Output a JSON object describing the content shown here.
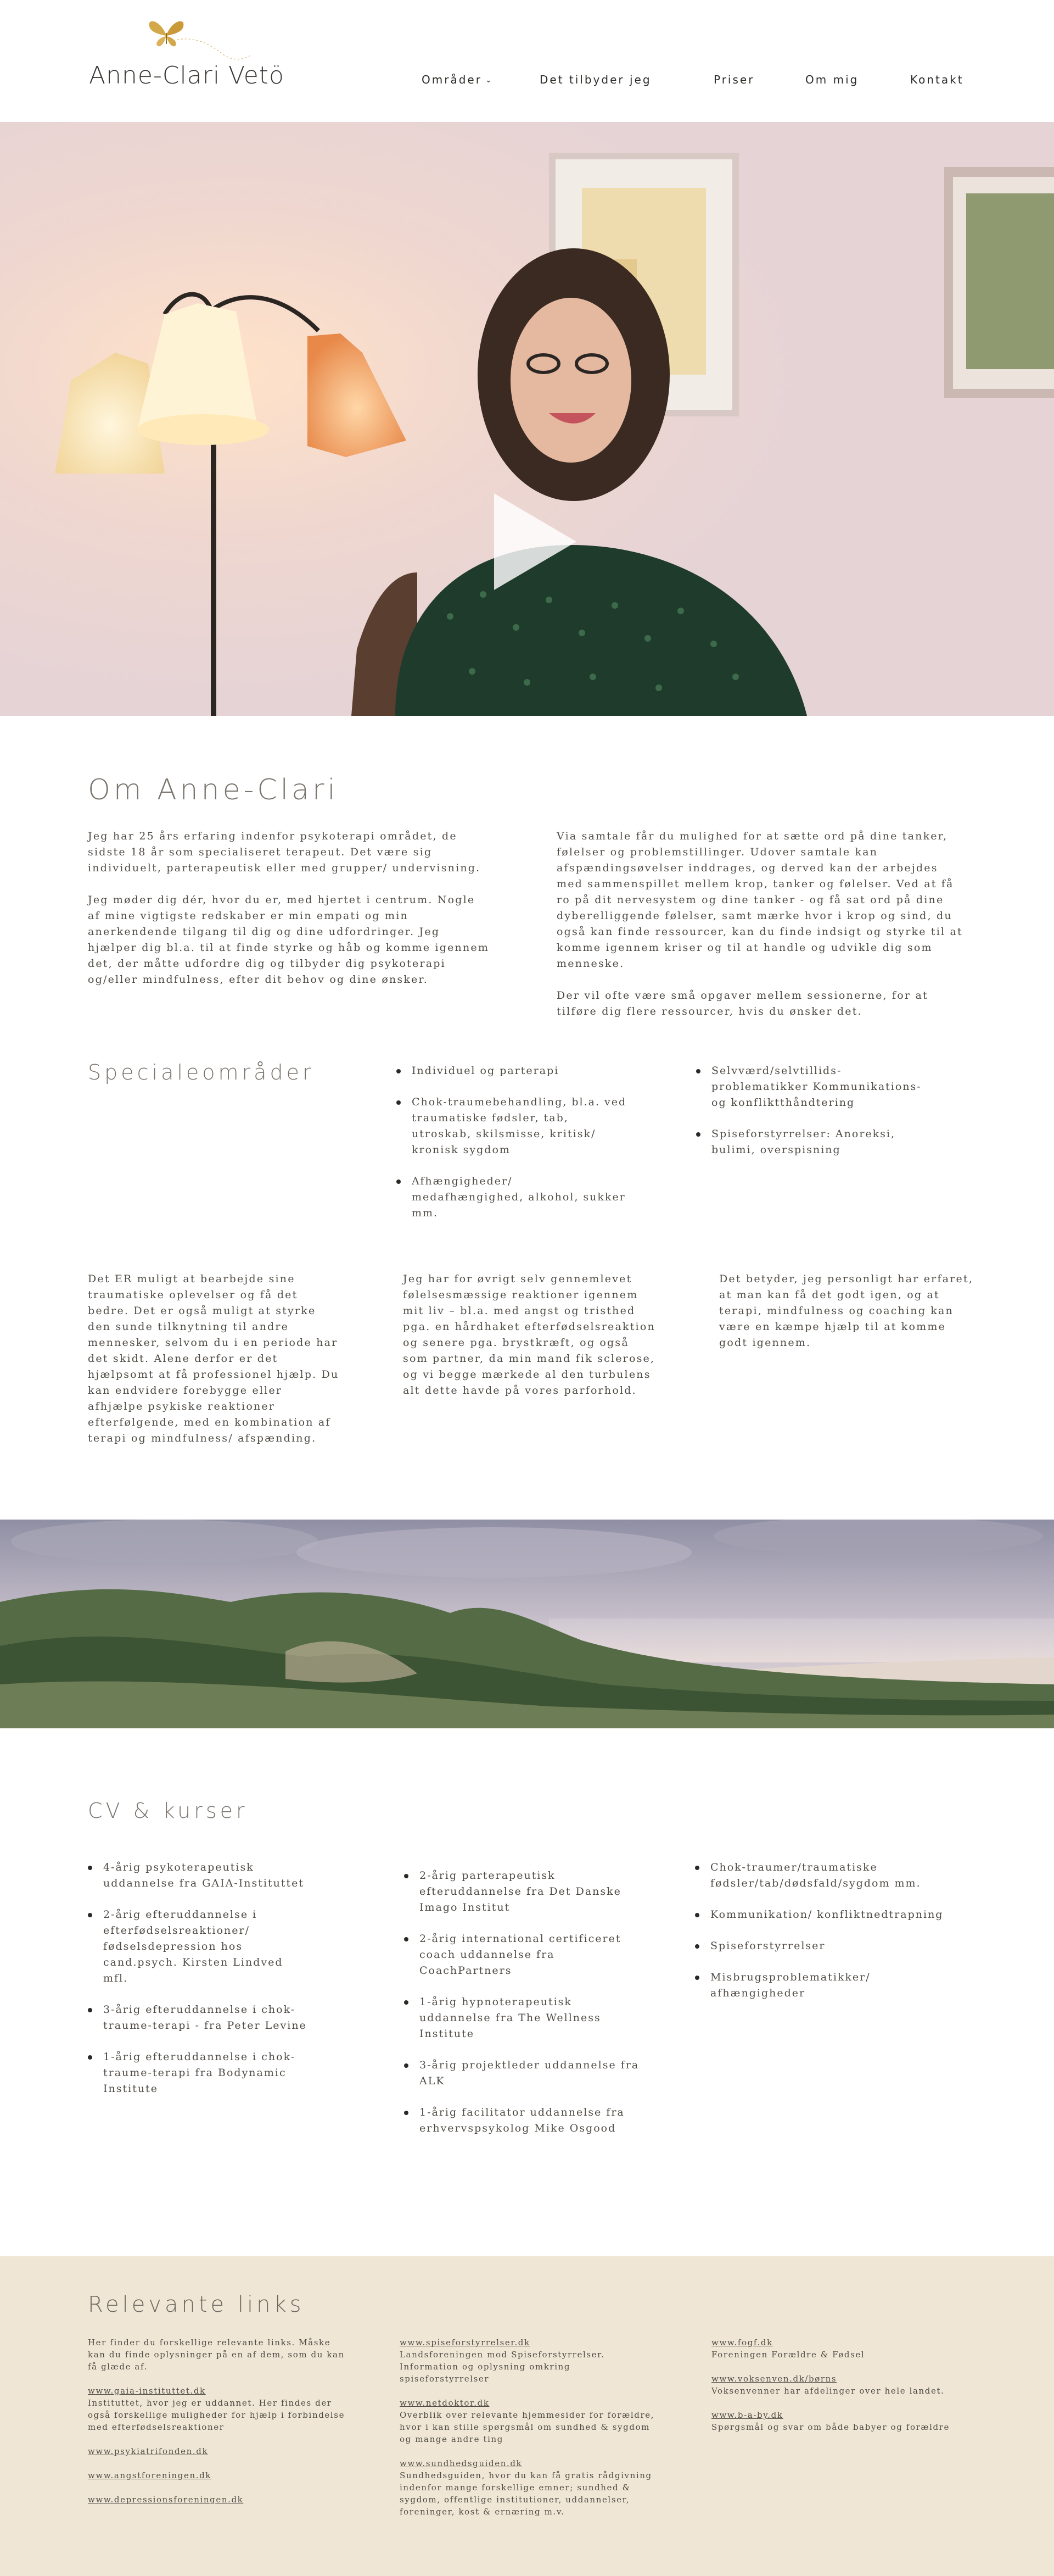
{
  "site": {
    "name": "Anne-Clari Vetö"
  },
  "nav": {
    "items": [
      {
        "label": "Områder",
        "has_dropdown": true
      },
      {
        "label": "Det tilbyder jeg"
      },
      {
        "label": "Priser"
      },
      {
        "label": "Om mig"
      },
      {
        "label": "Kontakt"
      }
    ]
  },
  "hero": {
    "video": "play-icon"
  },
  "about": {
    "title": "Om Anne-Clari",
    "left": [
      "Jeg har 25 års erfaring indenfor psykoterapi området, de sidste 18 år som specialiseret terapeut. Det være sig individuelt, parterapeutisk eller med grupper/ undervisning.",
      "Jeg møder dig dér, hvor du er, med hjertet i centrum. Nogle af mine vigtigste redskaber er min empati og min anerkendende tilgang til dig og dine udfordringer. Jeg hjælper dig bl.a. til at finde styrke og håb og komme igennem det, der måtte udfordre dig og tilbyder dig psykoterapi og/eller mindfulness, efter dit behov og dine ønsker."
    ],
    "right": [
      "Via samtale får du mulighed for at sætte ord på dine tanker, følelser og problemstillinger. Udover samtale kan afspændingsøvelser inddrages, og derved kan der arbejdes med sammenspillet mellem krop, tanker og følelser. Ved at få ro på dit nervesystem og dine tanker - og få sat ord på dine dyberelliggende følelser, samt mærke hvor i krop og sind, du også kan finde ressourcer, kan du finde indsigt og styrke til at komme igennem kriser og til at handle og udvikle dig som menneske.",
      "Der vil ofte være små opgaver mellem sessionerne, for at tilføre dig flere ressourcer, hvis du ønsker det."
    ]
  },
  "special": {
    "title": "Specialeområder",
    "col1": [
      "Individuel og parterapi",
      "Chok-traumebehandling, bl.a. ved traumatiske fødsler, tab, utroskab, skilsmisse, kritisk/ kronisk sygdom",
      "Afhængigheder/ medafhængighed, alkohol, sukker mm."
    ],
    "col2": [
      "Selvværd/selvtillids-problematikker Kommunikations- og konfliktthåndtering",
      "Spiseforstyrrelser: Anoreksi, bulimi, overspisning"
    ],
    "texts": [
      "Det ER muligt at bearbejde sine traumatiske oplevelser og få det bedre. Det er også muligt at styrke den sunde tilknytning til andre mennesker, selvom du i en periode har det skidt. Alene derfor er det hjælpsomt at få professionel hjælp. Du kan endvidere forebygge eller afhjælpe psykiske reaktioner efterfølgende, med en kombination af terapi og mindfulness/ afspænding.",
      "Jeg har for øvrigt selv gennemlevet følelsesmæssige reaktioner igennem mit liv – bl.a. med angst og tristhed pga. en hårdhaket efterfødselsreaktion og senere pga. brystkræft, og også som partner, da min mand fik sclerose, og vi begge mærkede al den turbulens alt dette havde på vores parforhold.",
      "Det betyder, jeg personligt har erfaret, at man kan få det godt igen, og at terapi, mindfulness og coaching kan være en kæmpe hjælp til at komme godt igennem."
    ]
  },
  "cv": {
    "title": "CV & kurser",
    "col1": [
      "4-årig psykoterapeutisk uddannelse fra GAIA-Instituttet",
      "2-årig efteruddannelse i efterfødselsreaktioner/ fødselsdepression hos cand.psych. Kirsten Lindved mfl.",
      "3-årig efteruddannelse i chok-traume-terapi - fra Peter Levine",
      "1-årig efteruddannelse i chok-traume-terapi fra Bodynamic Institute"
    ],
    "col2": [
      "2-årig parterapeutisk efteruddannelse fra Det Danske Imago Institut",
      "2-årig international certificeret coach uddannelse fra CoachPartners",
      "1-årig hypnoterapeutisk uddannelse fra The Wellness Institute",
      "3-årig projektleder uddannelse fra ALK",
      "1-årig facilitator uddannelse fra erhvervspsykolog Mike Osgood"
    ],
    "col3": [
      "Chok-traumer/traumatiske fødsler/tab/dødsfald/sygdom mm.",
      "Kommunikation/ konfliktnedtrapning",
      "Spiseforstyrrelser",
      "Misbrugsproblematikker/ afhængigheder"
    ]
  },
  "links": {
    "title": "Relevante links",
    "intro": "Her finder du forskellige relevante links. Måske kan du finde oplysninger på en af dem, som du kan få glæde af.",
    "col1": [
      {
        "url": "www.gaia-instituttet.dk",
        "desc": "Instituttet, hvor jeg er uddannet. Her findes der også forskellige muligheder for hjælp i forbindelse med efterfødselsreaktioner"
      },
      {
        "url": "www.psykiatrifonden.dk",
        "desc": ""
      },
      {
        "url": "www.angstforeningen.dk",
        "desc": ""
      },
      {
        "url": "www.depressionsforeningen.dk",
        "desc": ""
      }
    ],
    "col2": [
      {
        "url": "www.spiseforstyrrelser.dk",
        "desc": "Landsforeningen mod Spiseforstyrrelser. Information og oplysning omkring spiseforstyrrelser"
      },
      {
        "url": "www.netdoktor.dk",
        "desc": "Overblik over relevante hjemmesider for forældre, hvor i kan stille spørgsmål om sundhed & sygdom og mange andre ting"
      },
      {
        "url": "www.sundhedsguiden.dk",
        "desc": "Sundhedsguiden, hvor du kan få gratis rådgivning indenfor mange forskellige emner; sundhed & sygdom, offentlige institutioner, uddannelser, foreninger, kost & ernæring m.v."
      }
    ],
    "col3": [
      {
        "url": "www.fogf.dk",
        "desc": "Foreningen Forældre & Fødsel"
      },
      {
        "url": "www.voksenven.dk/børns",
        "desc": "Voksenvenner har afdelinger over hele landet."
      },
      {
        "url": "www.b-a-by.dk",
        "desc": "Spørgsmål og svar om både babyer og forældre"
      }
    ]
  },
  "colors": {
    "accent_gold": "#d2a84a",
    "links_background": "#efe6d5",
    "heading_gray": "#7a746d"
  }
}
